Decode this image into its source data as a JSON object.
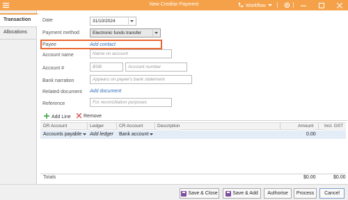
{
  "window": {
    "title": "New Creditor Payment",
    "workflow_label": "Workflow",
    "icons": [
      "app-icon",
      "workflow-icon",
      "settings-icon",
      "minimize-icon",
      "maximize-icon",
      "close-icon"
    ]
  },
  "tabs": [
    {
      "label": "Transaction",
      "active": true
    },
    {
      "label": "Allocations",
      "active": false
    }
  ],
  "form": {
    "date_label": "Date",
    "date_value": "31/10/2024",
    "payment_method_label": "Payment method",
    "payment_method_value": "Electronic funds transfer",
    "payee_label": "Payee",
    "payee_link": "Add contact",
    "account_name_label": "Account name",
    "account_name_placeholder": "Name on account",
    "account_number_label": "Account #",
    "bsb_placeholder": "BSB",
    "account_number_placeholder": "Account number",
    "bank_narration_label": "Bank narration",
    "bank_narration_placeholder": "Appears on payee's bank statement",
    "related_document_label": "Related document",
    "related_document_link": "Add document",
    "reference_label": "Reference",
    "reference_placeholder": "For reconciliation purposes"
  },
  "grid": {
    "add_line": "Add Line",
    "remove": "Remove",
    "columns": [
      "DR Account",
      "Ledger",
      "CR Account",
      "Description",
      "Amount",
      "Incl. GST"
    ],
    "rows": [
      {
        "dr_account": "Accounts payable",
        "ledger": "Add ledger",
        "cr_account": "Bank account",
        "description": "",
        "amount": "0.00",
        "incl_gst": ""
      }
    ],
    "totals_label": "Totals",
    "total_amount": "$0.00",
    "total_gst": "$0.00"
  },
  "footer": {
    "save_close": "Save & Close",
    "save_add": "Save & Add",
    "authorise": "Authorise",
    "process": "Process",
    "cancel": "Cancel"
  },
  "colors": {
    "accent": "#f5a14a",
    "highlight": "#e8662e",
    "link": "#2f6db5",
    "selected_row": "#e4ecf7"
  }
}
